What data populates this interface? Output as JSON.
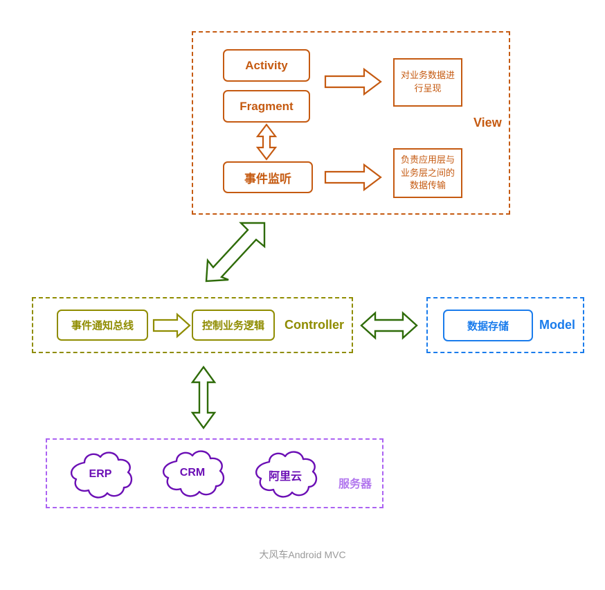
{
  "diagram": {
    "caption": "大风车Android MVC",
    "colors": {
      "view": "#C55A11",
      "controller": "#8F8C00",
      "model": "#1A7CEC",
      "server_border": "#AB62F2",
      "cloud": "#6B0FB5",
      "arrow_green": "#2E6B08",
      "caption": "#9A9A9A"
    },
    "view": {
      "label": "View",
      "boxes": [
        {
          "label": "Activity"
        },
        {
          "label": "Fragment"
        },
        {
          "label": "事件监听"
        }
      ],
      "notes": [
        {
          "lines": [
            "对业务数据进",
            "行呈现"
          ]
        },
        {
          "lines": [
            "负责应用层与",
            "业务层之间的",
            "数据传输"
          ]
        }
      ]
    },
    "controller": {
      "label": "Controller",
      "boxes": [
        {
          "label": "事件通知总线"
        },
        {
          "label": "控制业务逻辑"
        }
      ]
    },
    "model": {
      "label": "Model",
      "boxes": [
        {
          "label": "数据存储"
        }
      ]
    },
    "server": {
      "label": "服务器",
      "clouds": [
        {
          "label": "ERP"
        },
        {
          "label": "CRM"
        },
        {
          "label": "阿里云"
        }
      ]
    },
    "connectors": {
      "view_activity_to_note": "arrow-right-orange",
      "view_listener_to_note": "arrow-right-orange",
      "fragment_to_listener": "arrow-updown-orange",
      "view_to_controller": "arrow-diagonal-green",
      "controller_to_model": "arrow-leftright-green",
      "controller_to_server": "arrow-updown-green",
      "controller_bus_to_logic": "arrow-right-olive"
    }
  }
}
